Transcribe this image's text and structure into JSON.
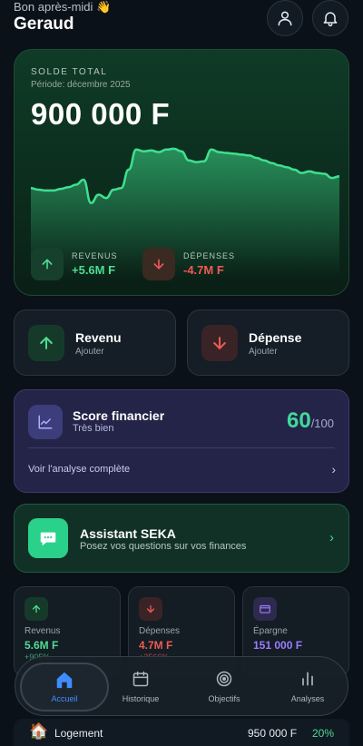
{
  "header": {
    "greeting": "Bon après-midi 👋",
    "username": "Geraud",
    "icons": [
      "user-icon",
      "bell-icon"
    ]
  },
  "balance": {
    "label": "SOLDE TOTAL",
    "period": "Période: décembre 2025",
    "amount": "900 000 F",
    "trend_points": [
      0.52,
      0.5,
      0.49,
      0.49,
      0.51,
      0.53,
      0.56,
      0.62,
      0.34,
      0.44,
      0.4,
      0.5,
      0.52,
      0.74,
      0.98,
      0.96,
      0.97,
      0.95,
      0.98,
      0.99,
      0.96,
      0.85,
      0.83,
      0.84,
      0.98,
      0.95,
      0.94,
      0.93,
      0.92,
      0.91,
      0.88,
      0.85,
      0.82,
      0.79,
      0.77,
      0.74,
      0.7,
      0.72,
      0.7,
      0.69,
      0.64,
      0.66
    ],
    "revenus": {
      "label": "REVENUS",
      "value": "+5.6M F"
    },
    "depenses": {
      "label": "DÉPENSES",
      "value": "-4.7M F"
    }
  },
  "actions": {
    "revenu": {
      "title": "Revenu",
      "subtitle": "Ajouter"
    },
    "depense": {
      "title": "Dépense",
      "subtitle": "Ajouter"
    }
  },
  "score": {
    "title": "Score financier",
    "subtitle": "Très bien",
    "value": "60",
    "max": "/100",
    "link": "Voir l'analyse complète"
  },
  "assistant": {
    "title": "Assistant SEKA",
    "subtitle": "Posez vos questions sur vos finances"
  },
  "stats": [
    {
      "label": "Revenus",
      "value": "5.6M F",
      "change": "+905%"
    },
    {
      "label": "Dépenses",
      "value": "4.7M F",
      "change": "+2566%"
    },
    {
      "label": "Épargne",
      "value": "151 000 F",
      "change": ""
    }
  ],
  "category": {
    "emoji": "🏠",
    "name": "Logement",
    "amount": "950 000 F",
    "percent": "20%"
  },
  "nav": [
    {
      "label": "Accueil",
      "active": true
    },
    {
      "label": "Historique",
      "active": false
    },
    {
      "label": "Objectifs",
      "active": false
    },
    {
      "label": "Analyses",
      "active": false
    }
  ],
  "colors": {
    "background": "#0b1118",
    "accent_green": "#4fdc94",
    "accent_red": "#ef5b52",
    "accent_purple": "#9b7dff",
    "accent_blue": "#3f8cff"
  }
}
